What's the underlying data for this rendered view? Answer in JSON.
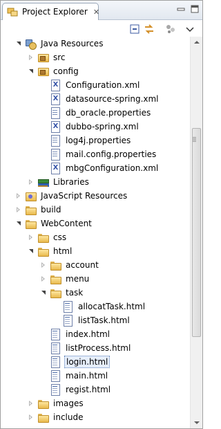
{
  "view": {
    "title": "Project Explorer",
    "tab_close_glyph": "✕"
  },
  "toolbar": {
    "items": [
      {
        "name": "collapse-all-icon"
      },
      {
        "name": "link-with-editor-icon"
      },
      {
        "name": "view-menu-icon"
      },
      {
        "name": "chevron-down-icon"
      }
    ]
  },
  "tree": [
    {
      "label": "Java Resources",
      "depth": 1,
      "icon": "java-resources-icon",
      "state": "open"
    },
    {
      "label": "src",
      "depth": 2,
      "icon": "package-folder-icon",
      "state": "closed"
    },
    {
      "label": "config",
      "depth": 2,
      "icon": "package-folder-icon",
      "state": "open"
    },
    {
      "label": "Configuration.xml",
      "depth": 3,
      "icon": "xml-file-icon",
      "state": "leaf"
    },
    {
      "label": "datasource-spring.xml",
      "depth": 3,
      "icon": "xml-file-icon",
      "state": "leaf"
    },
    {
      "label": "db_oracle.properties",
      "depth": 3,
      "icon": "properties-file-icon",
      "state": "leaf"
    },
    {
      "label": "dubbo-spring.xml",
      "depth": 3,
      "icon": "xml-file-icon",
      "state": "leaf"
    },
    {
      "label": "log4j.properties",
      "depth": 3,
      "icon": "properties-file-icon",
      "state": "leaf"
    },
    {
      "label": "mail.config.properties",
      "depth": 3,
      "icon": "properties-file-icon",
      "state": "leaf"
    },
    {
      "label": "mbgConfiguration.xml",
      "depth": 3,
      "icon": "xml-file-icon",
      "state": "leaf"
    },
    {
      "label": "Libraries",
      "depth": 2,
      "icon": "libraries-icon",
      "state": "closed"
    },
    {
      "label": "JavaScript Resources",
      "depth": 1,
      "icon": "javascript-resources-icon",
      "state": "closed"
    },
    {
      "label": "build",
      "depth": 1,
      "icon": "folder-icon",
      "state": "closed"
    },
    {
      "label": "WebContent",
      "depth": 1,
      "icon": "folder-icon",
      "state": "open"
    },
    {
      "label": "css",
      "depth": 2,
      "icon": "folder-icon",
      "state": "closed"
    },
    {
      "label": "html",
      "depth": 2,
      "icon": "folder-icon",
      "state": "open"
    },
    {
      "label": "account",
      "depth": 3,
      "icon": "folder-icon",
      "state": "closed"
    },
    {
      "label": "menu",
      "depth": 3,
      "icon": "folder-icon",
      "state": "closed"
    },
    {
      "label": "task",
      "depth": 3,
      "icon": "folder-icon",
      "state": "open"
    },
    {
      "label": "allocatTask.html",
      "depth": 4,
      "icon": "html-file-icon",
      "state": "leaf"
    },
    {
      "label": "listTask.html",
      "depth": 4,
      "icon": "html-file-icon",
      "state": "leaf"
    },
    {
      "label": "index.html",
      "depth": 3,
      "icon": "html-file-icon",
      "state": "leaf"
    },
    {
      "label": "listProcess.html",
      "depth": 3,
      "icon": "html-file-icon",
      "state": "leaf"
    },
    {
      "label": "login.html",
      "depth": 3,
      "icon": "html-file-icon",
      "state": "leaf",
      "selected": true
    },
    {
      "label": "main.html",
      "depth": 3,
      "icon": "html-file-icon",
      "state": "leaf"
    },
    {
      "label": "regist.html",
      "depth": 3,
      "icon": "html-file-icon",
      "state": "leaf"
    },
    {
      "label": "images",
      "depth": 2,
      "icon": "folder-icon",
      "state": "closed"
    },
    {
      "label": "include",
      "depth": 2,
      "icon": "folder-icon",
      "state": "closed"
    }
  ],
  "colors": {
    "selection_border": "#5b7fb8",
    "folder": "#e9b94c"
  }
}
